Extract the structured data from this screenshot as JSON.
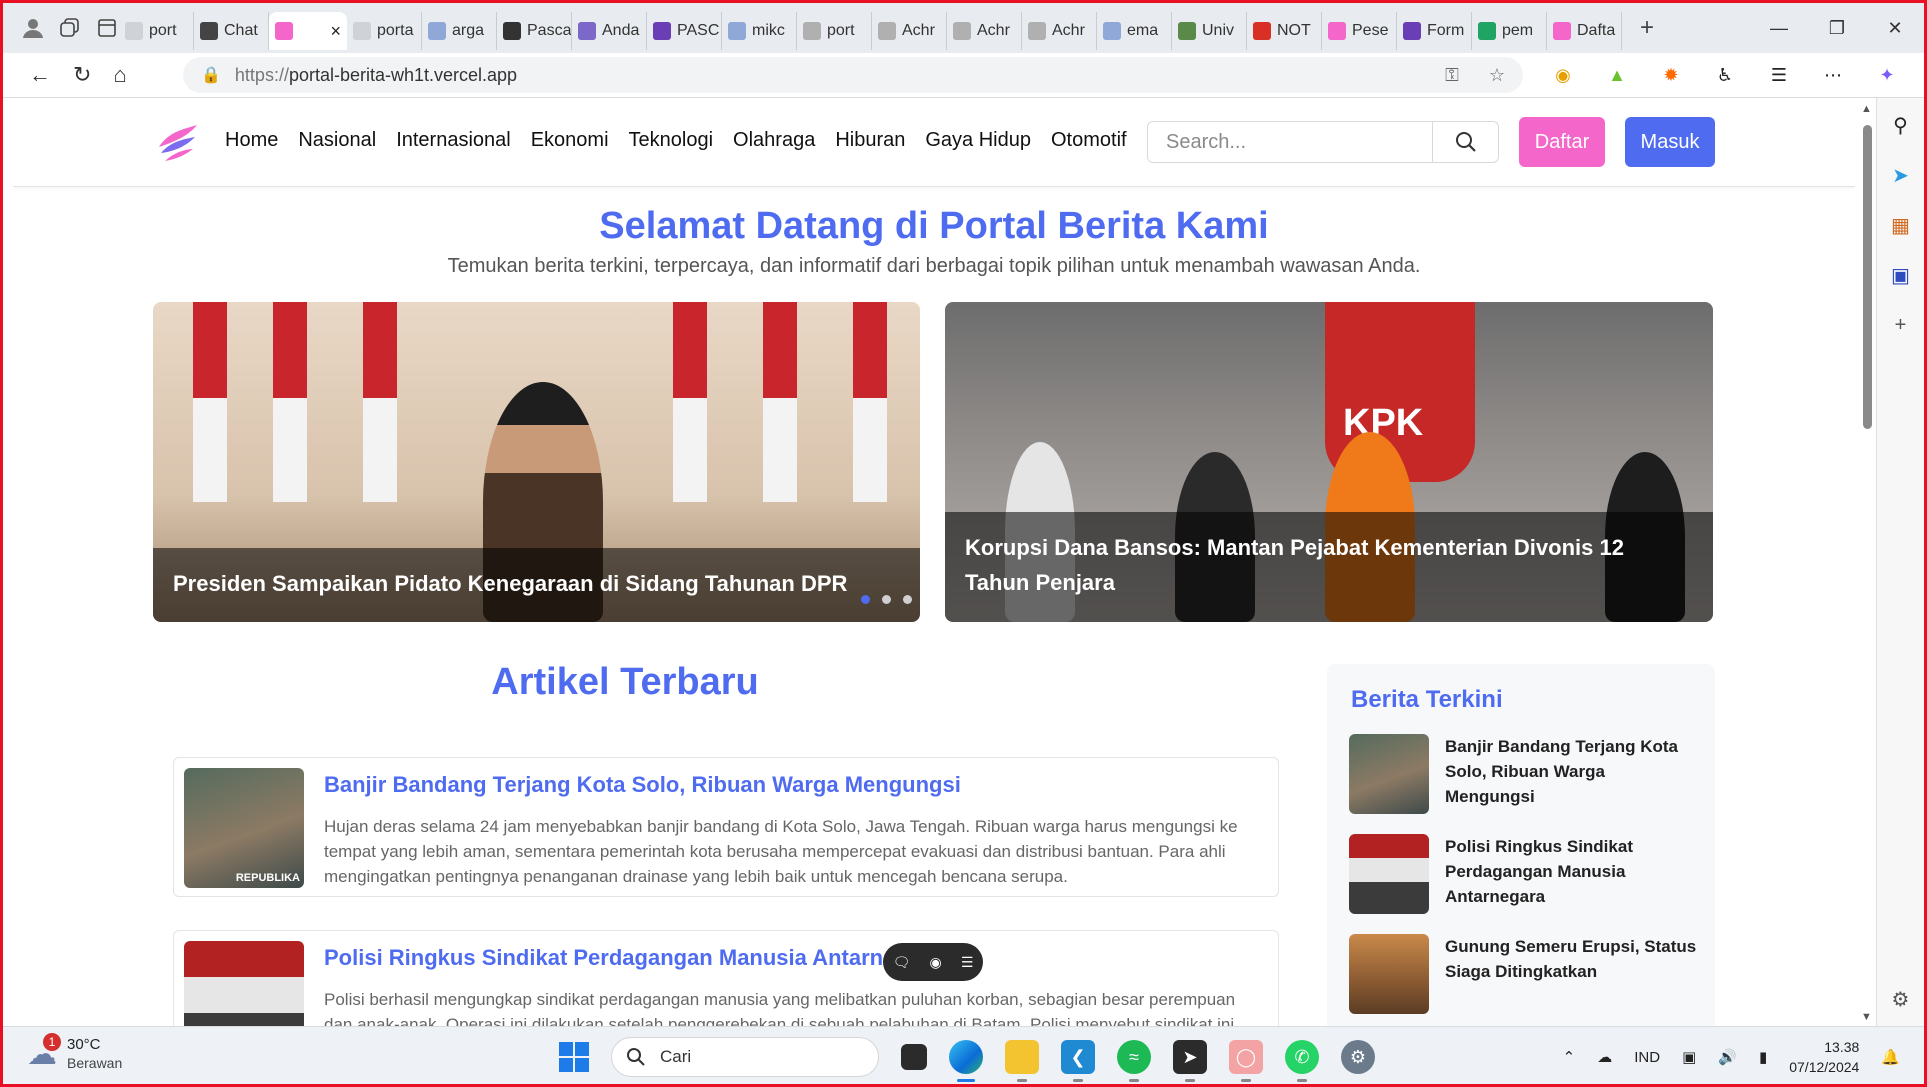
{
  "browser": {
    "tabs": [
      {
        "label": "port",
        "fav_color": "#cfd3d8",
        "icon": "page-icon"
      },
      {
        "label": "Chat",
        "fav_color": "#444444",
        "icon": "chatgpt-icon"
      },
      {
        "label": "",
        "fav_color": "#f466c9",
        "icon": "portal-logo-icon",
        "active": true
      },
      {
        "label": "porta",
        "fav_color": "#cfd3d8",
        "icon": "page-icon"
      },
      {
        "label": "arga",
        "fav_color": "#8fa8d8",
        "icon": "search-icon"
      },
      {
        "label": "Pasca",
        "fav_color": "#333333",
        "icon": "profile-icon"
      },
      {
        "label": "Anda",
        "fav_color": "#7b68c9",
        "icon": "form-icon"
      },
      {
        "label": "PASC",
        "fav_color": "#6a3fb5",
        "icon": "form-icon"
      },
      {
        "label": "mikc",
        "fav_color": "#8fa8d8",
        "icon": "search-icon"
      },
      {
        "label": "port",
        "fav_color": "#b0b0b0",
        "icon": "github-icon"
      },
      {
        "label": "Achr",
        "fav_color": "#b0b0b0",
        "icon": "github-icon"
      },
      {
        "label": "Achr",
        "fav_color": "#b0b0b0",
        "icon": "github-icon"
      },
      {
        "label": "Achr",
        "fav_color": "#b0b0b0",
        "icon": "github-icon"
      },
      {
        "label": "ema",
        "fav_color": "#8fa8d8",
        "icon": "search-icon"
      },
      {
        "label": "Univ",
        "fav_color": "#5a8a4a",
        "icon": "university-icon"
      },
      {
        "label": "NOT",
        "fav_color": "#d93025",
        "icon": "gmail-icon"
      },
      {
        "label": "Pese",
        "fav_color": "#f466c9",
        "icon": "portal-logo-icon"
      },
      {
        "label": "Form",
        "fav_color": "#6a3fb5",
        "icon": "form-icon"
      },
      {
        "label": "pem",
        "fav_color": "#1fa463",
        "icon": "drive-icon"
      },
      {
        "label": "Dafta",
        "fav_color": "#f466c9",
        "icon": "portal-logo-icon"
      }
    ],
    "url_prefix": "https://",
    "url_host": "portal-berita-wh1t.vercel.app"
  },
  "site": {
    "menu": [
      "Home",
      "Nasional",
      "Internasional",
      "Ekonomi",
      "Teknologi",
      "Olahraga",
      "Hiburan",
      "Gaya Hidup",
      "Otomotif"
    ],
    "search_placeholder": "Search...",
    "btn_daftar": "Daftar",
    "btn_masuk": "Masuk",
    "hero_title": "Selamat Datang di Portal Berita Kami",
    "hero_subtitle": "Temukan berita terkini, terpercaya, dan informatif dari berbagai topik pilihan untuk menambah wawasan Anda.",
    "slides": [
      {
        "caption": "Presiden Sampaikan Pidato Kenegaraan di Sidang Tahunan DPR"
      },
      {
        "caption": "Korupsi Dana Bansos: Mantan Pejabat Kementerian Divonis 12 Tahun Penjara",
        "logo_text": "KPK"
      }
    ],
    "articles_title": "Artikel Terbaru",
    "articles": [
      {
        "title": "Banjir Bandang Terjang Kota Solo, Ribuan Warga Mengungsi",
        "excerpt": "Hujan deras selama 24 jam menyebabkan banjir bandang di Kota Solo, Jawa Tengah. Ribuan warga harus mengungsi ke tempat yang lebih aman, sementara pemerintah kota berusaha mempercepat evakuasi dan distribusi bantuan. Para ahli mengingatkan pentingnya penanganan drainase yang lebih baik untuk mencegah bencana serupa.",
        "watermark": "REPUBLIKA"
      },
      {
        "title": "Polisi Ringkus Sindikat Perdagangan Manusia Antarnegara",
        "excerpt": "Polisi berhasil mengungkap sindikat perdagangan manusia yang melibatkan puluhan korban, sebagian besar perempuan dan anak-anak. Operasi ini dilakukan setelah penggerebekan di sebuah pelabuhan di Batam. Polisi menyebut sindikat ini"
      }
    ],
    "sidebar_title": "Berita Terkini",
    "sidebar_items": [
      {
        "title": "Banjir Bandang Terjang Kota Solo, Ribuan Warga Mengungsi"
      },
      {
        "title": "Polisi Ringkus Sindikat Perdagangan Manusia Antarnegara"
      },
      {
        "title": "Gunung Semeru Erupsi, Status Siaga Ditingkatkan"
      }
    ]
  },
  "taskbar": {
    "weather_temp": "30°C",
    "weather_desc": "Berawan",
    "weather_badge": "1",
    "search_label": "Cari",
    "lang": "IND",
    "time": "13.38",
    "date": "07/12/2024"
  },
  "colors": {
    "accent": "#4f6cf0",
    "pink": "#f466c9",
    "frame": "#e81123"
  }
}
